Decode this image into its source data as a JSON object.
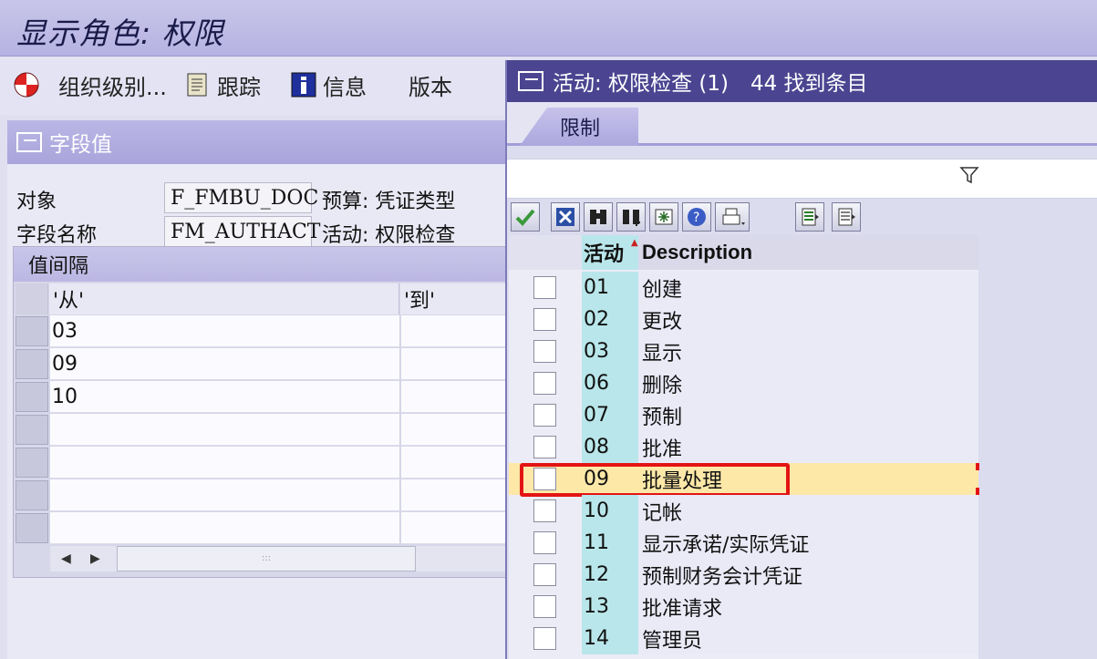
{
  "window": {
    "title": "显示角色: 权限"
  },
  "toolbar": {
    "items": [
      {
        "label": "组织级别...",
        "icon": "org-level-icon"
      },
      {
        "label": "跟踪",
        "icon": "trace-icon"
      },
      {
        "label": "信息",
        "icon": "info-icon"
      },
      {
        "label": "版本",
        "icon": ""
      }
    ]
  },
  "field_values": {
    "header": "字段值",
    "object_label": "对象",
    "object_value": "F_FMBU_DOC",
    "object_desc": "预算: 凭证类型",
    "field_label": "字段名称",
    "field_value": "FM_AUTHACT",
    "field_desc": "活动: 权限检查",
    "interval_title": "值间隔",
    "col_from": "'从'",
    "col_to": "'到'",
    "rows": [
      "03",
      "09",
      "10",
      "",
      "",
      "",
      ""
    ]
  },
  "popup": {
    "title": "活动: 权限检查 (1)",
    "count": "44 找到条目",
    "tab": "限制",
    "col_activity": "活动",
    "col_desc": "Description",
    "rows": [
      {
        "code": "01",
        "desc": "创建",
        "selected": false
      },
      {
        "code": "02",
        "desc": "更改",
        "selected": false
      },
      {
        "code": "03",
        "desc": "显示",
        "selected": false
      },
      {
        "code": "06",
        "desc": "删除",
        "selected": false
      },
      {
        "code": "07",
        "desc": "预制",
        "selected": false
      },
      {
        "code": "08",
        "desc": "批准",
        "selected": false
      },
      {
        "code": "09",
        "desc": "批量处理",
        "selected": true
      },
      {
        "code": "10",
        "desc": "记帐",
        "selected": false
      },
      {
        "code": "11",
        "desc": "显示承诺/实际凭证",
        "selected": false
      },
      {
        "code": "12",
        "desc": "预制财务会计凭证",
        "selected": false
      },
      {
        "code": "13",
        "desc": "批准请求",
        "selected": false
      },
      {
        "code": "14",
        "desc": "管理员",
        "selected": false
      }
    ]
  },
  "colors": {
    "title_bar": "#b6b2e2",
    "popup_title": "#4b4591",
    "activity_column": "#b9e6ea",
    "selected_row": "#fde8a8",
    "highlight_box": "#e31414"
  }
}
